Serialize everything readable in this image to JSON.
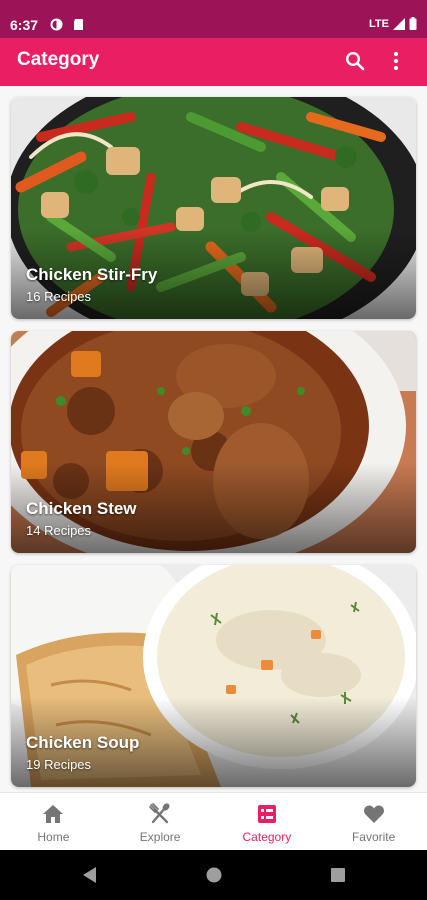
{
  "status_bar": {
    "time": "6:37",
    "network": "LTE"
  },
  "app_bar": {
    "title": "Category"
  },
  "categories": [
    {
      "title": "Chicken Stir-Fry",
      "count": "16 Recipes"
    },
    {
      "title": "Chicken Stew",
      "count": "14 Recipes"
    },
    {
      "title": "Chicken Soup",
      "count": "19 Recipes"
    }
  ],
  "bottom_nav": {
    "items": [
      {
        "label": "Home",
        "icon": "home-icon"
      },
      {
        "label": "Explore",
        "icon": "utensils-icon"
      },
      {
        "label": "Category",
        "icon": "category-icon"
      },
      {
        "label": "Favorite",
        "icon": "heart-icon"
      }
    ],
    "active": "Category"
  },
  "colors": {
    "status_bar": "#9c1457",
    "primary": "#e91e63",
    "nav_inactive": "#757575"
  }
}
